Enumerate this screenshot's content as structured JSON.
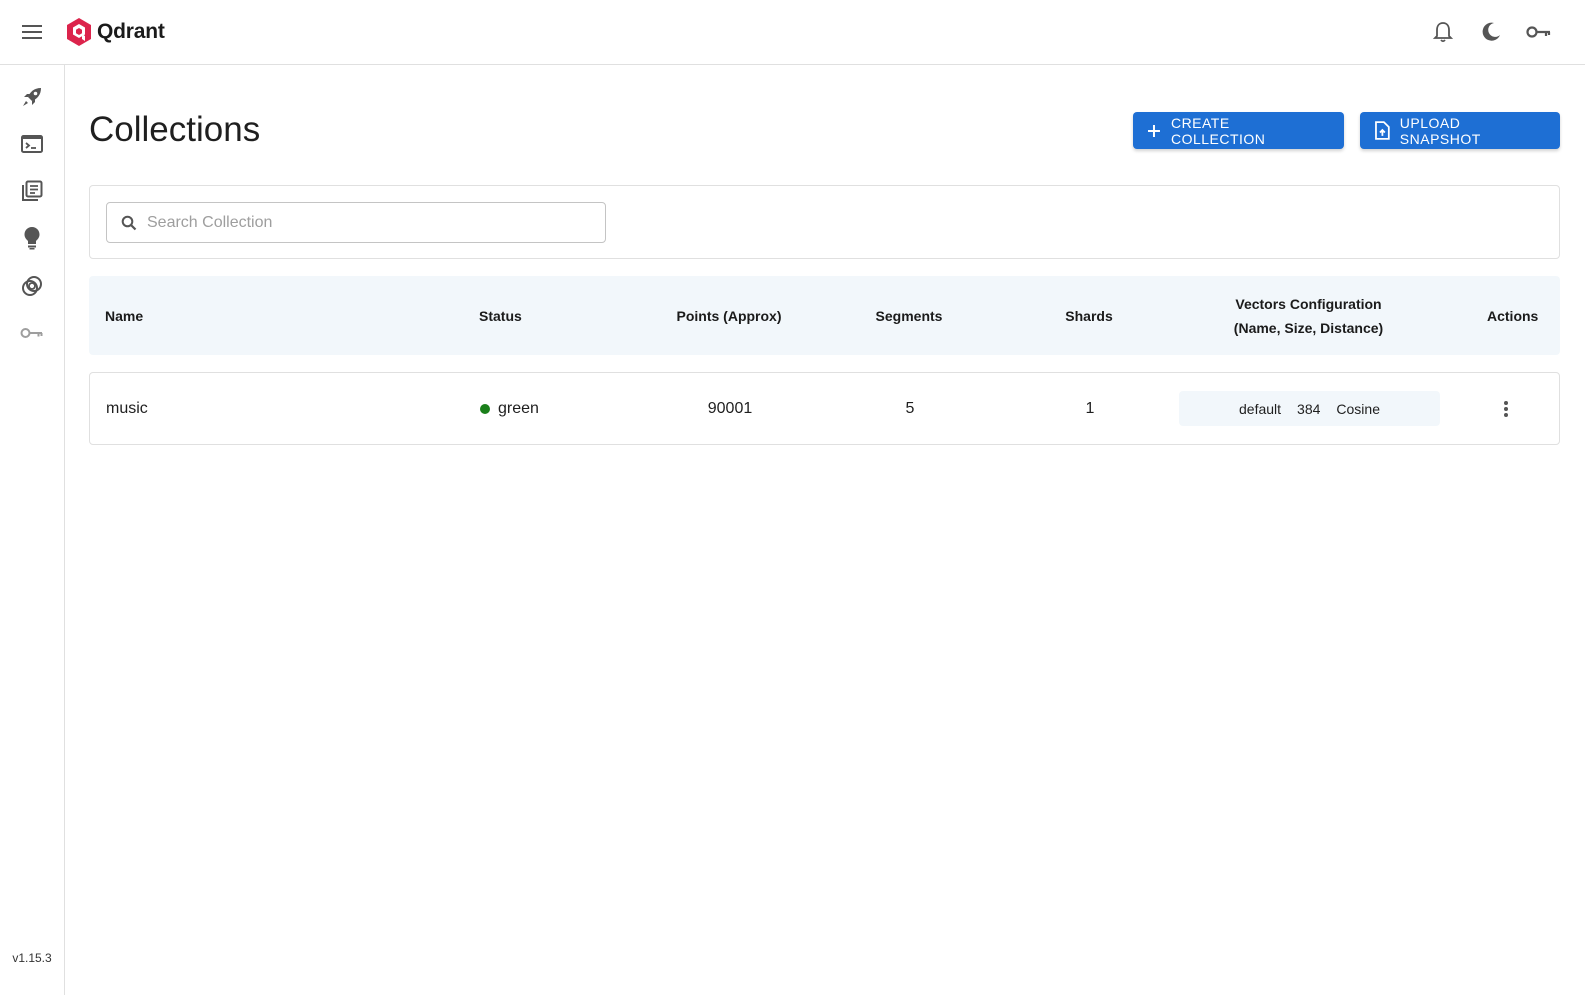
{
  "app": {
    "name": "Qdrant",
    "brand_color": "#dc244c",
    "accent_color": "#1e6fd4"
  },
  "topbar": {
    "menu_icon": "hamburger-menu-icon",
    "actions": [
      {
        "name": "notifications",
        "icon": "bell-icon"
      },
      {
        "name": "theme-toggle",
        "icon": "moon-icon"
      },
      {
        "name": "api-key",
        "icon": "key-icon"
      }
    ]
  },
  "sidebar": {
    "items": [
      {
        "name": "welcome",
        "icon": "rocket-icon"
      },
      {
        "name": "console",
        "icon": "terminal-icon"
      },
      {
        "name": "collections",
        "icon": "library-icon"
      },
      {
        "name": "tutorial",
        "icon": "lightbulb-icon"
      },
      {
        "name": "datasets",
        "icon": "datasets-icon"
      },
      {
        "name": "access-tokens",
        "icon": "key-icon"
      }
    ],
    "version": "v1.15.3"
  },
  "page": {
    "title": "Collections",
    "create_label": "CREATE COLLECTION",
    "upload_label": "UPLOAD SNAPSHOT"
  },
  "search": {
    "placeholder": "Search Collection",
    "value": ""
  },
  "table": {
    "headers": {
      "name": "Name",
      "status": "Status",
      "points": "Points (Approx)",
      "segments": "Segments",
      "shards": "Shards",
      "vectors_line1": "Vectors Configuration",
      "vectors_line2": "(Name, Size, Distance)",
      "actions": "Actions"
    },
    "rows": [
      {
        "name": "music",
        "status": "green",
        "status_color": "#1a7f1a",
        "points": "90001",
        "segments": "5",
        "shards": "1",
        "vector": {
          "name": "default",
          "size": "384",
          "distance": "Cosine"
        }
      }
    ]
  }
}
